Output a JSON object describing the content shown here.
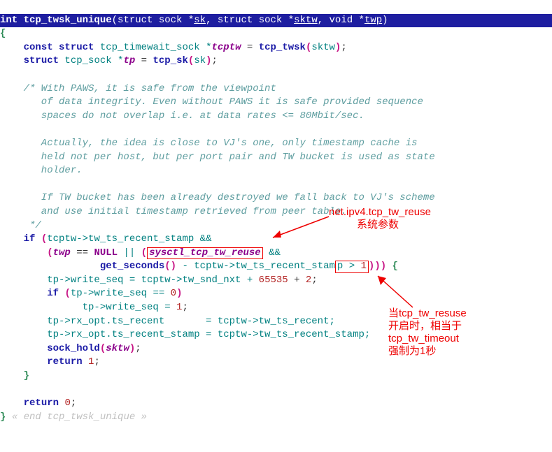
{
  "signature": {
    "ret": "int ",
    "fn": "tcp_twsk_unique",
    "params_raw": "(struct sock *",
    "p1": "sk",
    "sep1": ", struct sock *",
    "p2": "sktw",
    "sep2": ", void *",
    "p3": "twp",
    "close": ")"
  },
  "l2": "{",
  "l3": {
    "a": "    ",
    "b": "const",
    "c": " ",
    "d": "struct",
    "e": " tcp_timewait_sock *",
    "f": "tcptw",
    "g": " = ",
    "h": "tcp_twsk",
    "i": "(",
    "j": "sktw",
    "k": ")",
    "l": ";"
  },
  "l4": {
    "a": "    ",
    "b": "struct",
    "c": " tcp_sock *",
    "d": "tp",
    "e": " = ",
    "f": "tcp_sk",
    "g": "(",
    "h": "sk",
    "i": ")",
    "j": ";"
  },
  "comment_block": "    /* With PAWS, it is safe from the viewpoint\n       of data integrity. Even without PAWS it is safe provided sequence\n       spaces do not overlap i.e. at data rates <= 80Mbit/sec.\n\n       Actually, the idea is close to VJ's one, only timestamp cache is\n       held not per host, but per port pair and TW bucket is used as state\n       holder.\n\n       If TW bucket has been already destroyed we fall back to VJ's scheme\n       and use initial timestamp retrieved from peer table.\n     */",
  "l_if": {
    "a": "    ",
    "b": "if",
    "c": " ",
    "d": "(",
    "e": "tcptw->tw_ts_recent_stamp &&"
  },
  "l_if2": {
    "a": "        ",
    "b": "(",
    "c": "twp",
    "d": " == ",
    "e": "NULL",
    "f": " || ",
    "g": "(",
    "box1": "sysctl_tcp_tw_reuse",
    "h": " &&"
  },
  "l_if3": {
    "a": "                 ",
    "b": "get_seconds",
    "c": "()",
    "d": " - tcptw->tw_ts_recent_stam",
    "box2_a": "p > ",
    "box2_b": "1",
    "e": ")",
    "f": ")",
    "g": ")",
    "h": " {"
  },
  "l_ws": {
    "a": "        tp->write_seq = tcptw->tw_snd_nxt + ",
    "b": "65535",
    "c": " + ",
    "d": "2",
    "e": ";"
  },
  "l_if0": {
    "a": "        ",
    "b": "if",
    "c": " ",
    "d": "(",
    "e": "tp->write_seq == ",
    "f": "0",
    "g": ")"
  },
  "l_ws1": {
    "a": "              tp->write_seq = ",
    "b": "1",
    "c": ";"
  },
  "l_rx1": "        tp->rx_opt.ts_recent       = tcptw->tw_ts_recent;",
  "l_rx2": "        tp->rx_opt.ts_recent_stamp = tcptw->tw_ts_recent_stamp;",
  "l_sh": {
    "a": "        ",
    "b": "sock_hold",
    "c": "(",
    "d": "sktw",
    "e": ")",
    "f": ";"
  },
  "l_ret1": {
    "a": "        ",
    "b": "return",
    "c": " ",
    "d": "1",
    "e": ";"
  },
  "l_cb": "    }",
  "l_ret0": {
    "a": "    ",
    "b": "return",
    "c": " ",
    "d": "0",
    "e": ";"
  },
  "l_end": {
    "a": "} ",
    "b": "« end tcp_twsk_unique »"
  },
  "annot1": {
    "l1": "net.ipv4.tcp_tw_reuse",
    "l2": "系统参数"
  },
  "annot2": {
    "l1": "当tcp_tw_resuse",
    "l2": "开启时，相当于",
    "l3": "tcp_tw_timeout",
    "l4": "强制为1秒"
  }
}
